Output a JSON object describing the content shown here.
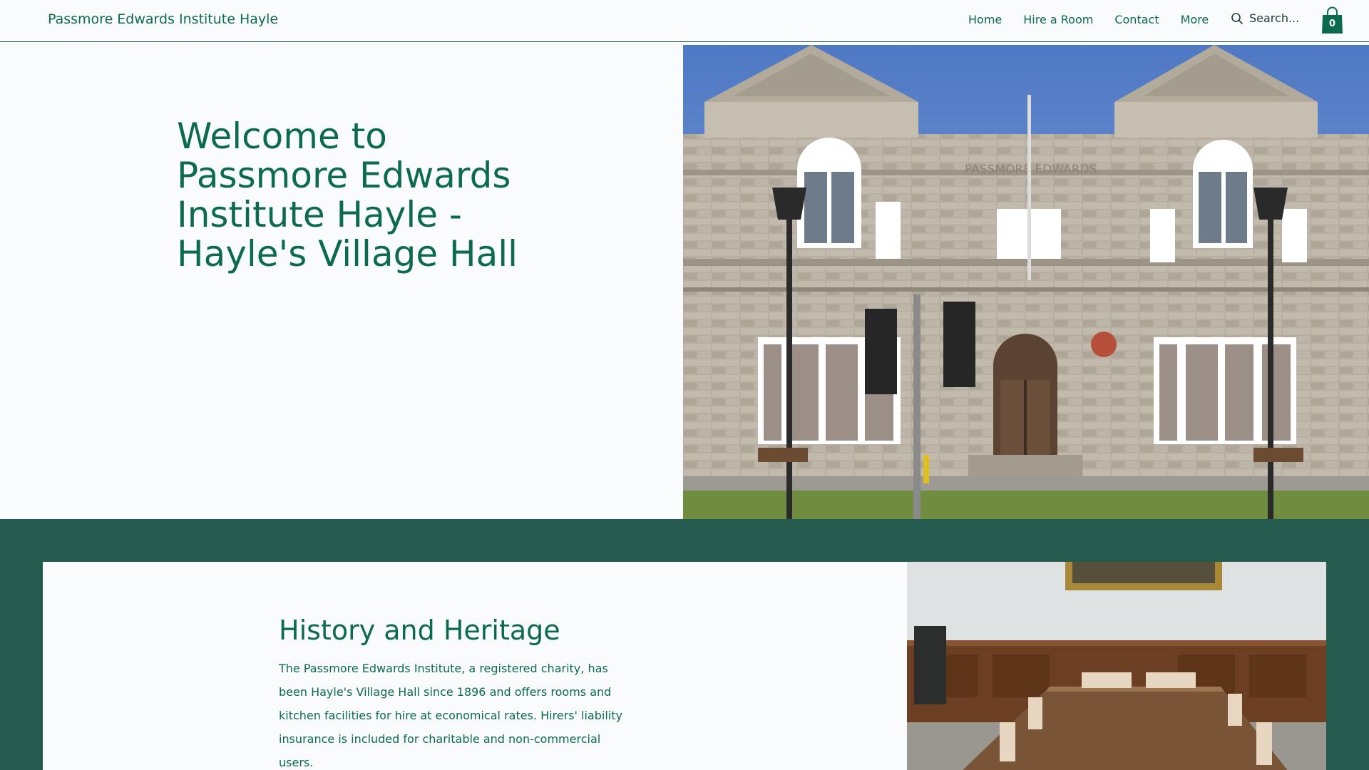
{
  "header": {
    "site_title": "Passmore Edwards Institute Hayle",
    "nav": [
      "Home",
      "Hire a Room",
      "Contact",
      "More"
    ],
    "search_placeholder": "Search...",
    "cart_count": "0"
  },
  "hero": {
    "title": "Welcome to Passmore Edwards Institute Hayle - Hayle's Village Hall",
    "building_sign": "PASSMORE EDWARDS"
  },
  "history": {
    "title": "History and Heritage",
    "text": "The Passmore Edwards Institute, a registered charity, has been Hayle's Village Hall since 1896 and offers rooms and kitchen facilities for hire at economical rates. Hirers' liability insurance is included for charitable and non-commercial users."
  },
  "colors": {
    "brand_green": "#0c6b4f",
    "band_green": "#255b4f",
    "page_bg": "#f9fbfd"
  },
  "icons": [
    "search-icon",
    "shopping-bag-icon"
  ]
}
